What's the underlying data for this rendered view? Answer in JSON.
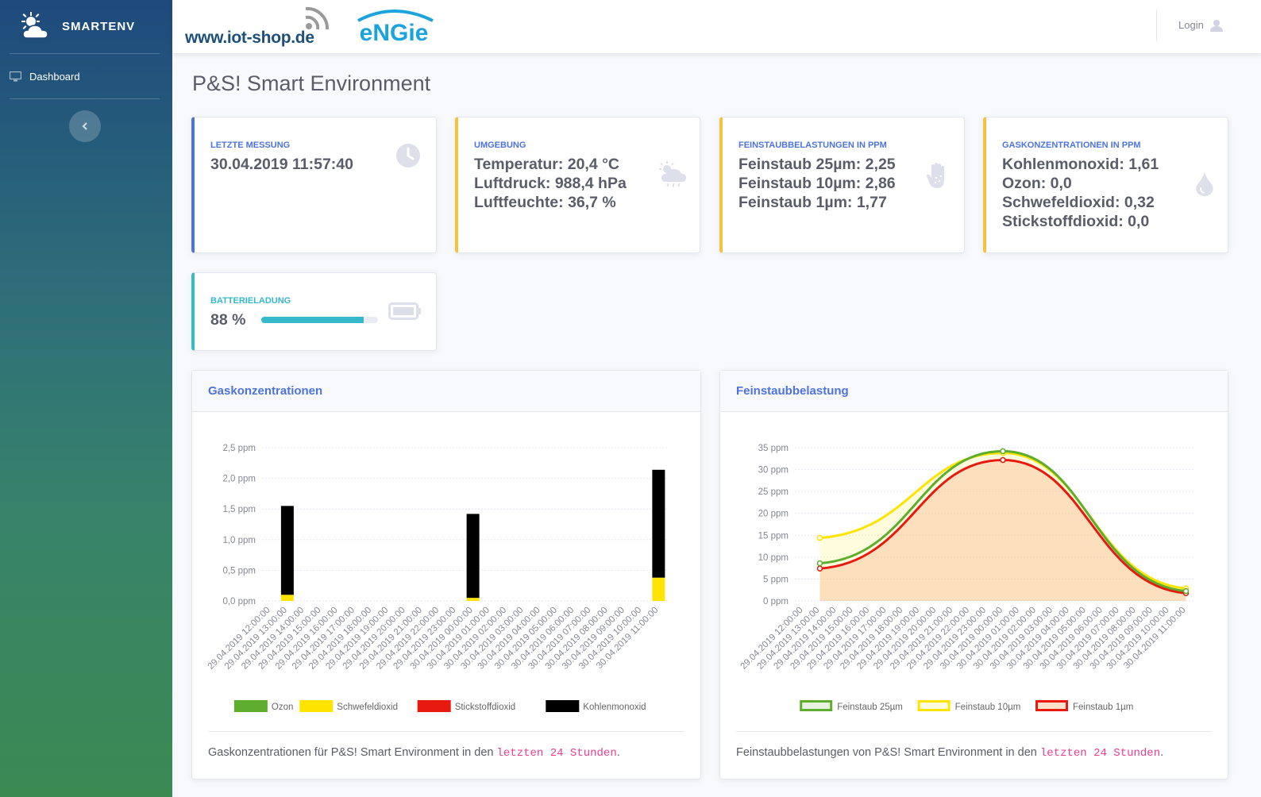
{
  "sidebar": {
    "brand": "SMARTENV",
    "nav": [
      {
        "label": "Dashboard",
        "icon": "monitor-icon"
      }
    ],
    "toggle_icon": "chevron-left-icon"
  },
  "topbar": {
    "logo_text": "www.iot-shop.de",
    "partner_logo": "eNGie",
    "login_label": "Login"
  },
  "page_title": "P&S! Smart Environment",
  "cards": {
    "last_measurement": {
      "label": "Letzte Messung",
      "lines": [
        "30.04.2019 11:57:40"
      ],
      "icon": "clock-icon"
    },
    "environment": {
      "label": "Umgebung",
      "lines": [
        "Temperatur: 20,4 °C",
        "Luftdruck: 988,4 hPa",
        "Luftfeuchte: 36,7 %"
      ],
      "icon": "cloud-sun-rain-icon"
    },
    "particulates": {
      "label": "Feinstaubbelastungen in PPM",
      "lines": [
        "Feinstaub 25µm: 2,25",
        "Feinstaub 10µm: 2,86",
        "Feinstaub 1µm: 1,77"
      ],
      "icon": "hand-dots-icon"
    },
    "gases": {
      "label": "Gaskonzentrationen in PPM",
      "lines": [
        "Kohlenmonoxid: 1,61",
        "Ozon: 0,0",
        "Schwefeldioxid: 0,32",
        "Stickstoffdioxid: 0,0"
      ],
      "icon": "tint-icon"
    },
    "battery": {
      "label": "Batterieladung",
      "value": "88 %",
      "level": 0.88,
      "icon": "battery-icon"
    }
  },
  "colors": {
    "primary": "#4e73df",
    "warning": "#f6c23e",
    "info": "#36b9cc"
  },
  "chart_titles": {
    "gas": "Gaskonzentrationen",
    "dust": "Feinstaubbelastung"
  },
  "footers": {
    "gas": {
      "text": "Gaskonzentrationen für P&S! Smart Environment in den ",
      "code": "letzten 24 Stunden",
      "end": "."
    },
    "dust": {
      "text": "Feinstaubbelastungen von P&S! Smart Environment in den ",
      "code": "letzten 24 Stunden",
      "end": "."
    }
  },
  "chart_data": [
    {
      "type": "bar",
      "stacked": true,
      "title": "Gaskonzentrationen",
      "ylim": [
        0,
        2.5
      ],
      "yticks": [
        "0,0 ppm",
        "0,5 ppm",
        "1,0 ppm",
        "1,5 ppm",
        "2,0 ppm",
        "2,5 ppm"
      ],
      "categories": [
        "29.04.2019 12:00:00",
        "29.04.2019 13:00:00",
        "29.04.2019 14:00:00",
        "29.04.2019 15:00:00",
        "29.04.2019 16:00:00",
        "29.04.2019 17:00:00",
        "29.04.2019 18:00:00",
        "29.04.2019 19:00:00",
        "29.04.2019 20:00:00",
        "29.04.2019 21:00:00",
        "29.04.2019 22:00:00",
        "29.04.2019 23:00:00",
        "30.04.2019 00:00:00",
        "30.04.2019 01:00:00",
        "30.04.2019 02:00:00",
        "30.04.2019 03:00:00",
        "30.04.2019 04:00:00",
        "30.04.2019 05:00:00",
        "30.04.2019 06:00:00",
        "30.04.2019 07:00:00",
        "30.04.2019 08:00:00",
        "30.04.2019 09:00:00",
        "30.04.2019 10:00:00",
        "30.04.2019 11:00:00"
      ],
      "series": [
        {
          "name": "Ozon",
          "color": "#5fad2e",
          "values": [
            0,
            0,
            0,
            0,
            0,
            0,
            0,
            0,
            0,
            0,
            0,
            0,
            0,
            0,
            0,
            0,
            0,
            0,
            0,
            0,
            0,
            0,
            0,
            0
          ]
        },
        {
          "name": "Schwefeldioxid",
          "color": "#ffe400",
          "values": [
            0,
            0.1,
            0,
            0,
            0,
            0,
            0,
            0,
            0,
            0,
            0,
            0,
            0.05,
            0,
            0,
            0,
            0,
            0,
            0,
            0,
            0,
            0,
            0,
            0.38
          ]
        },
        {
          "name": "Stickstoffdioxid",
          "color": "#e8190f",
          "values": [
            0,
            0,
            0,
            0,
            0,
            0,
            0,
            0,
            0,
            0,
            0,
            0,
            0,
            0,
            0,
            0,
            0,
            0,
            0,
            0,
            0,
            0,
            0,
            0
          ]
        },
        {
          "name": "Kohlenmonoxid",
          "color": "#000000",
          "values": [
            0,
            1.45,
            0,
            0,
            0,
            0,
            0,
            0,
            0,
            0,
            0,
            0,
            1.37,
            0,
            0,
            0,
            0,
            0,
            0,
            0,
            0,
            0,
            0,
            1.76
          ]
        }
      ],
      "legend": "bottom"
    },
    {
      "type": "line",
      "title": "Feinstaubbelastung",
      "ylim": [
        0,
        35
      ],
      "yticks": [
        "0 ppm",
        "5 ppm",
        "10 ppm",
        "15 ppm",
        "20 ppm",
        "25 ppm",
        "30 ppm",
        "35 ppm"
      ],
      "categories": [
        "29.04.2019 12:00:00",
        "29.04.2019 13:00:00",
        "29.04.2019 14:00:00",
        "29.04.2019 15:00:00",
        "29.04.2019 16:00:00",
        "29.04.2019 17:00:00",
        "29.04.2019 18:00:00",
        "29.04.2019 19:00:00",
        "29.04.2019 20:00:00",
        "29.04.2019 21:00:00",
        "29.04.2019 22:00:00",
        "29.04.2019 23:00:00",
        "30.04.2019 00:00:00",
        "30.04.2019 01:00:00",
        "30.04.2019 02:00:00",
        "30.04.2019 03:00:00",
        "30.04.2019 04:00:00",
        "30.04.2019 05:00:00",
        "30.04.2019 06:00:00",
        "30.04.2019 07:00:00",
        "30.04.2019 08:00:00",
        "30.04.2019 09:00:00",
        "30.04.2019 10:00:00",
        "30.04.2019 11:00:00"
      ],
      "points": [
        {
          "series": "Feinstaub 25µm",
          "index": 1,
          "value": 8.6
        },
        {
          "series": "Feinstaub 25µm",
          "index": 12,
          "value": 34.2
        },
        {
          "series": "Feinstaub 25µm",
          "index": 23,
          "value": 2.25
        },
        {
          "series": "Feinstaub 10µm",
          "index": 1,
          "value": 14.4
        },
        {
          "series": "Feinstaub 10µm",
          "index": 12,
          "value": 33.8
        },
        {
          "series": "Feinstaub 10µm",
          "index": 23,
          "value": 2.86
        },
        {
          "series": "Feinstaub 1µm",
          "index": 1,
          "value": 7.4
        },
        {
          "series": "Feinstaub 1µm",
          "index": 12,
          "value": 32.2
        },
        {
          "series": "Feinstaub 1µm",
          "index": 23,
          "value": 1.77
        }
      ],
      "series": [
        {
          "name": "Feinstaub 25µm",
          "color": "#5fad2e",
          "fill": "rgba(95,173,46,0.15)"
        },
        {
          "name": "Feinstaub 10µm",
          "color": "#ffe400",
          "fill": "rgba(255,240,120,0.25)"
        },
        {
          "name": "Feinstaub 1µm",
          "color": "#e8190f",
          "fill": "rgba(250,200,160,0.55)"
        }
      ],
      "legend": "bottom"
    }
  ]
}
